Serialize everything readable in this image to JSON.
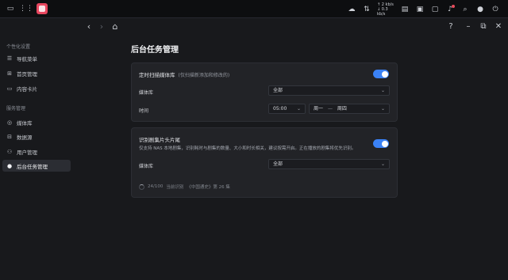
{
  "os_bar": {
    "speed_up": "↑ 2 kb/s",
    "speed_down": "↓ 0.3 kb/s"
  },
  "sidebar": {
    "section1_title": "个性化设置",
    "section1_items": [
      {
        "label": "导航菜单",
        "icon": "menu-icon"
      },
      {
        "label": "首页管理",
        "icon": "home-grid-icon"
      },
      {
        "label": "内容卡片",
        "icon": "card-icon"
      }
    ],
    "section2_title": "服务管理",
    "section2_items": [
      {
        "label": "媒体库",
        "icon": "media-library-icon"
      },
      {
        "label": "数据源",
        "icon": "data-source-icon"
      },
      {
        "label": "用户管理",
        "icon": "users-icon"
      },
      {
        "label": "后台任务管理",
        "icon": "task-icon",
        "active": true
      }
    ]
  },
  "main": {
    "title": "后台任务管理",
    "scan_card": {
      "heading": "定时扫描媒体库",
      "heading_note": "(仅扫描新添加和修改的)",
      "enabled": true,
      "media_label": "媒体库",
      "media_value": "全部",
      "time_label": "时间",
      "time_value": "05:00",
      "day_from": "周一",
      "day_sep": "—",
      "day_to": "周四"
    },
    "intro_card": {
      "heading": "识别剧集片头片尾",
      "description": "仅支持 NAS 本地剧集，识别耗时与剧集的数量、大小和时长相关，建议按需开启。正在播放的剧集将优先识别。",
      "enabled": true,
      "media_label": "媒体库",
      "media_value": "全部",
      "progress_text": "24/100",
      "progress_status": "当前识别",
      "progress_item": "《中国通史》第 26 集"
    }
  },
  "colors": {
    "accent": "#3b82f6",
    "background": "#18191c",
    "card": "#222327"
  }
}
